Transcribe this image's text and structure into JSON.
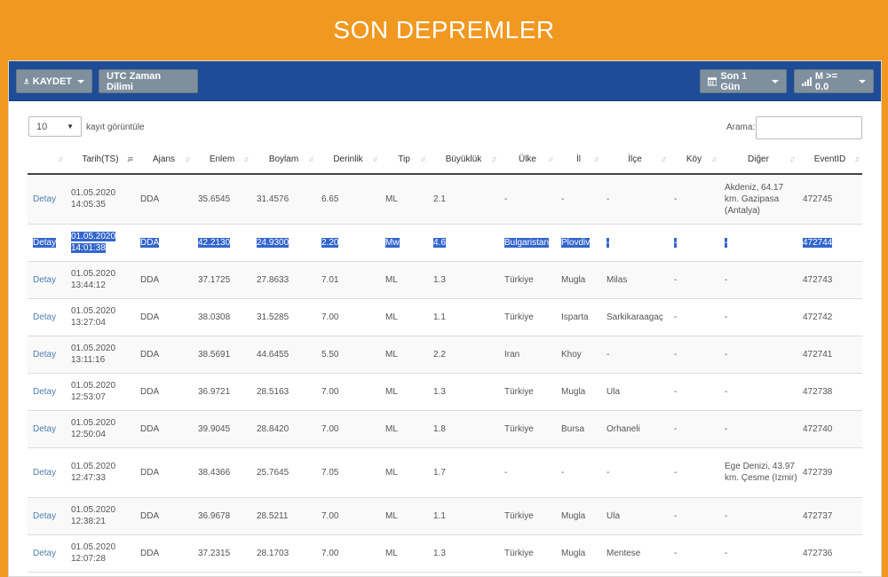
{
  "page": {
    "title": "SON DEPREMLER"
  },
  "toolbar": {
    "save_label": "KAYDET",
    "timezone_label": "UTC Zaman Dilimi",
    "period_label": "Son 1 Gün",
    "magnitude_label": "M >= 0.0"
  },
  "controls": {
    "page_length": "10",
    "page_length_label": "kayıt görüntüle",
    "search_label": "Arama:",
    "search_value": ""
  },
  "table": {
    "columns": [
      "",
      "Tarih(TS)",
      "Ajans",
      "Enlem",
      "Boylam",
      "Derinlik",
      "Tip",
      "Büyüklük",
      "Ülke",
      "İl",
      "İlçe",
      "Köy",
      "Diğer",
      "EventID"
    ],
    "detail_label": "Detay",
    "rows": [
      {
        "date": "01.05.2020",
        "time": "14:05:35",
        "agency": "DDA",
        "lat": "35.6545",
        "lon": "31.4576",
        "depth": "6.65",
        "type": "ML",
        "mag": "2.1",
        "country": "-",
        "province": "-",
        "district": "-",
        "village": "-",
        "other": "Akdeniz, 64.17 km. Gazipasa (Antalya)",
        "event": "472745"
      },
      {
        "date": "01.05.2020",
        "time": "14:01:38",
        "agency": "DDA",
        "lat": "42.2130",
        "lon": "24.9300",
        "depth": "2.20",
        "type": "Mw",
        "mag": "4.6",
        "country": "Bulgaristan",
        "province": "Plovdiv",
        "district": "-",
        "village": "-",
        "other": "-",
        "event": "472744"
      },
      {
        "date": "01.05.2020",
        "time": "13:44:12",
        "agency": "DDA",
        "lat": "37.1725",
        "lon": "27.8633",
        "depth": "7.01",
        "type": "ML",
        "mag": "1.3",
        "country": "Türkiye",
        "province": "Mugla",
        "district": "Milas",
        "village": "-",
        "other": "-",
        "event": "472743"
      },
      {
        "date": "01.05.2020",
        "time": "13:27:04",
        "agency": "DDA",
        "lat": "38.0308",
        "lon": "31.5285",
        "depth": "7.00",
        "type": "ML",
        "mag": "1.1",
        "country": "Türkiye",
        "province": "Isparta",
        "district": "Sarkikaraagaç",
        "village": "-",
        "other": "-",
        "event": "472742"
      },
      {
        "date": "01.05.2020",
        "time": "13:11:16",
        "agency": "DDA",
        "lat": "38.5691",
        "lon": "44.6455",
        "depth": "5.50",
        "type": "ML",
        "mag": "2.2",
        "country": "Iran",
        "province": "Khoy",
        "district": "-",
        "village": "-",
        "other": "-",
        "event": "472741"
      },
      {
        "date": "01.05.2020",
        "time": "12:53:07",
        "agency": "DDA",
        "lat": "36.9721",
        "lon": "28.5163",
        "depth": "7.00",
        "type": "ML",
        "mag": "1.3",
        "country": "Türkiye",
        "province": "Mugla",
        "district": "Ula",
        "village": "-",
        "other": "-",
        "event": "472738"
      },
      {
        "date": "01.05.2020",
        "time": "12:50:04",
        "agency": "DDA",
        "lat": "39.9045",
        "lon": "28.8420",
        "depth": "7.00",
        "type": "ML",
        "mag": "1.8",
        "country": "Türkiye",
        "province": "Bursa",
        "district": "Orhaneli",
        "village": "-",
        "other": "-",
        "event": "472740"
      },
      {
        "date": "01.05.2020",
        "time": "12:47:33",
        "agency": "DDA",
        "lat": "38.4366",
        "lon": "25.7645",
        "depth": "7.05",
        "type": "ML",
        "mag": "1.7",
        "country": "-",
        "province": "-",
        "district": "-",
        "village": "-",
        "other": "Ege Denizi, 43.97 km. Çesme (Izmir)",
        "event": "472739"
      },
      {
        "date": "01.05.2020",
        "time": "12:38:21",
        "agency": "DDA",
        "lat": "36.9678",
        "lon": "28.5211",
        "depth": "7.00",
        "type": "ML",
        "mag": "1.1",
        "country": "Türkiye",
        "province": "Mugla",
        "district": "Ula",
        "village": "-",
        "other": "-",
        "event": "472737"
      },
      {
        "date": "01.05.2020",
        "time": "12:07:28",
        "agency": "DDA",
        "lat": "37.2315",
        "lon": "28.1703",
        "depth": "7.00",
        "type": "ML",
        "mag": "1.3",
        "country": "Türkiye",
        "province": "Mugla",
        "district": "Mentese",
        "village": "-",
        "other": "-",
        "event": "472736"
      }
    ]
  }
}
